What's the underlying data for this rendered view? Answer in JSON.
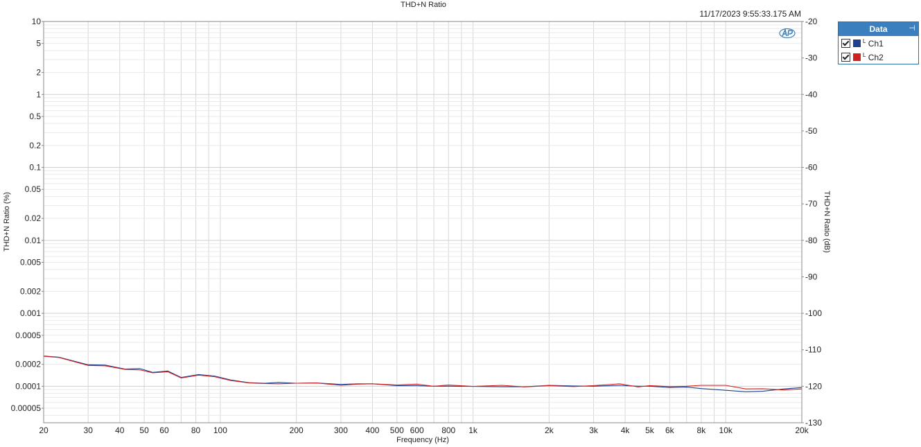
{
  "timestamp": "11/17/2023 9:55:33.175 AM",
  "legend": {
    "title": "Data",
    "items": [
      {
        "label": "Ch1",
        "prefix": "L",
        "color": "#1f3f8f"
      },
      {
        "label": "Ch2",
        "prefix": "L",
        "color": "#d02020"
      }
    ]
  },
  "chart_data": {
    "type": "line",
    "title": "THD+N Ratio",
    "xlabel": "Frequency (Hz)",
    "ylabel": "THD+N Ratio (%)",
    "ylabel_right": "THD+N Ratio (dB)",
    "x_scale": "log",
    "y_scale": "log",
    "xlim": [
      20,
      20000
    ],
    "ylim_percent": [
      3.16e-05,
      10
    ],
    "ylim_db": [
      -130,
      -20
    ],
    "grid": true,
    "legend_position": "right",
    "x_ticks": [
      {
        "v": 20,
        "l": "20"
      },
      {
        "v": 30,
        "l": "30"
      },
      {
        "v": 40,
        "l": "40"
      },
      {
        "v": 50,
        "l": "50"
      },
      {
        "v": 60,
        "l": "60"
      },
      {
        "v": 80,
        "l": "80"
      },
      {
        "v": 100,
        "l": "100"
      },
      {
        "v": 200,
        "l": "200"
      },
      {
        "v": 300,
        "l": "300"
      },
      {
        "v": 400,
        "l": "400"
      },
      {
        "v": 500,
        "l": "500"
      },
      {
        "v": 600,
        "l": "600"
      },
      {
        "v": 800,
        "l": "800"
      },
      {
        "v": 1000,
        "l": "1k"
      },
      {
        "v": 2000,
        "l": "2k"
      },
      {
        "v": 3000,
        "l": "3k"
      },
      {
        "v": 4000,
        "l": "4k"
      },
      {
        "v": 5000,
        "l": "5k"
      },
      {
        "v": 6000,
        "l": "6k"
      },
      {
        "v": 8000,
        "l": "8k"
      },
      {
        "v": 10000,
        "l": "10k"
      },
      {
        "v": 20000,
        "l": "20k"
      }
    ],
    "x_minor": [
      70,
      90,
      700,
      900,
      7000,
      9000
    ],
    "y_ticks_percent": [
      {
        "v": 10,
        "l": "10"
      },
      {
        "v": 5,
        "l": "5"
      },
      {
        "v": 2,
        "l": "2"
      },
      {
        "v": 1,
        "l": "1"
      },
      {
        "v": 0.5,
        "l": "0.5"
      },
      {
        "v": 0.2,
        "l": "0.2"
      },
      {
        "v": 0.1,
        "l": "0.1"
      },
      {
        "v": 0.05,
        "l": "0.05"
      },
      {
        "v": 0.02,
        "l": "0.02"
      },
      {
        "v": 0.01,
        "l": "0.01"
      },
      {
        "v": 0.005,
        "l": "0.005"
      },
      {
        "v": 0.002,
        "l": "0.002"
      },
      {
        "v": 0.001,
        "l": "0.001"
      },
      {
        "v": 0.0005,
        "l": "0.0005"
      },
      {
        "v": 0.0002,
        "l": "0.0002"
      },
      {
        "v": 0.0001,
        "l": "0.0001"
      },
      {
        "v": 5e-05,
        "l": "0.00005"
      }
    ],
    "y_ticks_db": [
      {
        "v": -20,
        "l": "-20"
      },
      {
        "v": -30,
        "l": "-30"
      },
      {
        "v": -40,
        "l": "-40"
      },
      {
        "v": -50,
        "l": "-50"
      },
      {
        "v": -60,
        "l": "-60"
      },
      {
        "v": -70,
        "l": "-70"
      },
      {
        "v": -80,
        "l": "-80"
      },
      {
        "v": -90,
        "l": "-90"
      },
      {
        "v": -100,
        "l": "-100"
      },
      {
        "v": -110,
        "l": "-110"
      },
      {
        "v": -120,
        "l": "-120"
      },
      {
        "v": -130,
        "l": "-130"
      }
    ],
    "series": [
      {
        "name": "Ch1",
        "color": "#1f3f8f",
        "points": [
          [
            20,
            0.00026
          ],
          [
            23,
            0.00025
          ],
          [
            30,
            0.000197
          ],
          [
            35,
            0.000195
          ],
          [
            42,
            0.000172
          ],
          [
            48,
            0.000175
          ],
          [
            54,
            0.000155
          ],
          [
            62,
            0.000162
          ],
          [
            70,
            0.000132
          ],
          [
            82,
            0.000145
          ],
          [
            95,
            0.000138
          ],
          [
            110,
            0.000122
          ],
          [
            130,
            0.000112
          ],
          [
            150,
            0.00011
          ],
          [
            170,
            0.000113
          ],
          [
            200,
            0.00011
          ],
          [
            240,
            0.000111
          ],
          [
            300,
            0.000106
          ],
          [
            350,
            0.000108
          ],
          [
            400,
            0.000108
          ],
          [
            500,
            0.000102
          ],
          [
            600,
            0.000102
          ],
          [
            700,
            0.0001
          ],
          [
            800,
            0.0001
          ],
          [
            1000,
            9.95e-05
          ],
          [
            1300,
            9.85e-05
          ],
          [
            1600,
            9.85e-05
          ],
          [
            2000,
            0.000103
          ],
          [
            2500,
            0.000101
          ],
          [
            3000,
            0.0001
          ],
          [
            3800,
            0.000103
          ],
          [
            4500,
            0.0001
          ],
          [
            5000,
            0.0001
          ],
          [
            6000,
            9.6e-05
          ],
          [
            7000,
            9.75e-05
          ],
          [
            8000,
            9.3e-05
          ],
          [
            10000,
            8.8e-05
          ],
          [
            12000,
            8.4e-05
          ],
          [
            14000,
            8.55e-05
          ],
          [
            17000,
            9.2e-05
          ],
          [
            20000,
            9.6e-05
          ]
        ]
      },
      {
        "name": "Ch2",
        "color": "#d02020",
        "points": [
          [
            20,
            0.000258
          ],
          [
            23,
            0.000248
          ],
          [
            30,
            0.000193
          ],
          [
            35,
            0.000191
          ],
          [
            42,
            0.00017
          ],
          [
            48,
            0.000168
          ],
          [
            54,
            0.000153
          ],
          [
            62,
            0.000158
          ],
          [
            70,
            0.00013
          ],
          [
            82,
            0.000142
          ],
          [
            95,
            0.000135
          ],
          [
            110,
            0.00012
          ],
          [
            130,
            0.000111
          ],
          [
            150,
            0.000109
          ],
          [
            170,
            0.000108
          ],
          [
            200,
            0.00011
          ],
          [
            240,
            0.000111
          ],
          [
            300,
            0.000103
          ],
          [
            350,
            0.000107
          ],
          [
            400,
            0.000108
          ],
          [
            500,
            0.000104
          ],
          [
            600,
            0.000107
          ],
          [
            700,
            0.0001
          ],
          [
            800,
            0.000104
          ],
          [
            1000,
            9.95e-05
          ],
          [
            1300,
            0.000103
          ],
          [
            1600,
            9.8e-05
          ],
          [
            2000,
            0.000102
          ],
          [
            2500,
            9.9e-05
          ],
          [
            3000,
            0.000102
          ],
          [
            3800,
            0.000108
          ],
          [
            4500,
            9.8e-05
          ],
          [
            5000,
            0.000102
          ],
          [
            6000,
            9.9e-05
          ],
          [
            7000,
            0.0001
          ],
          [
            8000,
            0.000103
          ],
          [
            10000,
            0.000103
          ],
          [
            12000,
            9.2e-05
          ],
          [
            14000,
            9.25e-05
          ],
          [
            17000,
            8.9e-05
          ],
          [
            20000,
            9.2e-05
          ]
        ]
      }
    ]
  }
}
